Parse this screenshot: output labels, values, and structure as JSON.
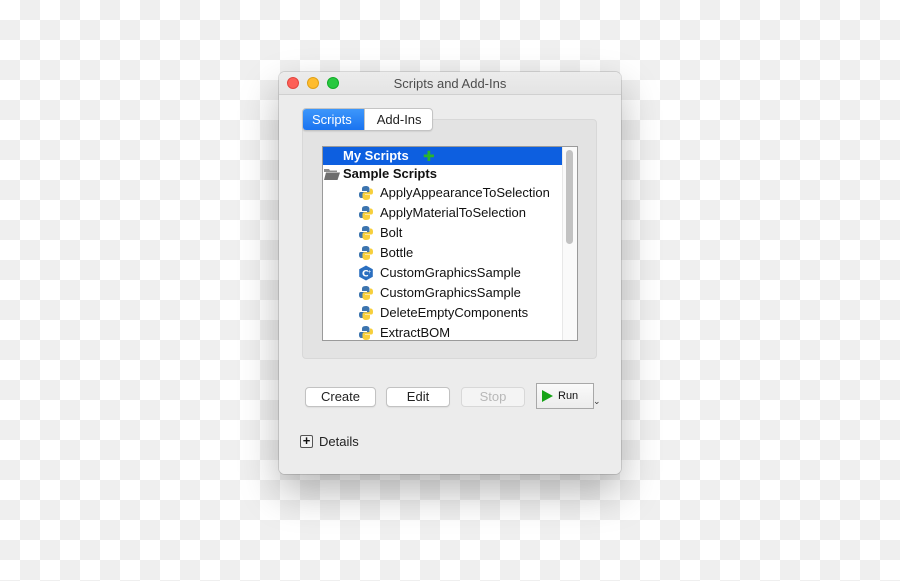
{
  "window": {
    "title": "Scripts and Add-Ins",
    "controls": [
      "close",
      "minimize",
      "maximize"
    ]
  },
  "tabs": [
    {
      "label": "Scripts",
      "active": true
    },
    {
      "label": "Add-Ins",
      "active": false
    }
  ],
  "tree": {
    "groups": [
      {
        "label": "My Scripts",
        "selected": true,
        "icon": "add-icon",
        "children": []
      },
      {
        "label": "Sample Scripts",
        "selected": false,
        "icon": "folder-open-icon",
        "children": [
          {
            "label": "ApplyAppearanceToSelection",
            "icon": "python-icon"
          },
          {
            "label": "ApplyMaterialToSelection",
            "icon": "python-icon"
          },
          {
            "label": "Bolt",
            "icon": "python-icon"
          },
          {
            "label": "Bottle",
            "icon": "python-icon"
          },
          {
            "label": "CustomGraphicsSample",
            "icon": "cpp-icon"
          },
          {
            "label": "CustomGraphicsSample",
            "icon": "python-icon"
          },
          {
            "label": "DeleteEmptyComponents",
            "icon": "python-icon"
          },
          {
            "label": "ExtractBOM",
            "icon": "python-icon"
          }
        ]
      }
    ]
  },
  "buttons": {
    "create": "Create",
    "edit": "Edit",
    "stop": "Stop",
    "run": "Run"
  },
  "details": {
    "toggle": "+",
    "label": "Details"
  },
  "colors": {
    "selection": "#0d5fe0",
    "tab_active": "#1a73f0",
    "run_icon": "#15a315",
    "add_icon": "#2ab52a"
  }
}
